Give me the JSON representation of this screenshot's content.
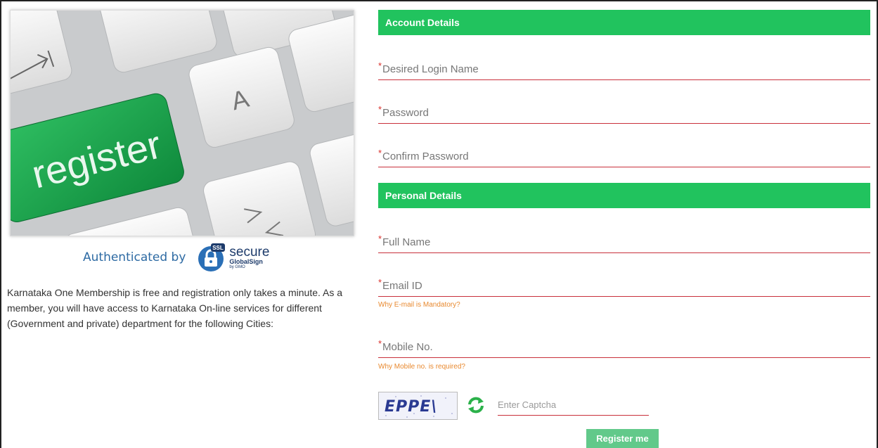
{
  "hero": {
    "key_text": "register",
    "letter_a": "A",
    "letter_z": "Z"
  },
  "auth": {
    "label": "Authenticated by",
    "seal_badge": "SSL",
    "seal_main": "secure",
    "seal_sub": "GlobalSign",
    "seal_by": "by GMO"
  },
  "description": "Karnataka One Membership is free and registration only takes a minute. As a member, you will have access to Karnataka On-line services for different (Government and private) department for the following Cities:",
  "account_section": {
    "title": "Account Details",
    "fields": [
      {
        "placeholder": "Desired Login Name",
        "value": ""
      },
      {
        "placeholder": "Password",
        "value": ""
      },
      {
        "placeholder": "Confirm Password",
        "value": ""
      }
    ]
  },
  "personal_section": {
    "title": "Personal Details",
    "fields": [
      {
        "placeholder": "Full Name",
        "value": ""
      },
      {
        "placeholder": "Email ID",
        "value": ""
      },
      {
        "placeholder": "Mobile No.",
        "value": ""
      }
    ],
    "email_hint": "Why E-mail is Mandatory?",
    "mobile_hint": "Why Mobile no. is required?"
  },
  "required_marker": "*",
  "captcha": {
    "image_text": "EPPE\\",
    "placeholder": "Enter Captcha",
    "value": ""
  },
  "register_button": "Register me",
  "colors": {
    "accent_green": "#21c35e",
    "button_green": "#62c98a",
    "underline_red": "#c9303b",
    "hint_orange": "#e8892f",
    "auth_blue": "#2d6aa3"
  },
  "icons": {
    "refresh": "refresh-icon",
    "lock": "lock-icon"
  }
}
